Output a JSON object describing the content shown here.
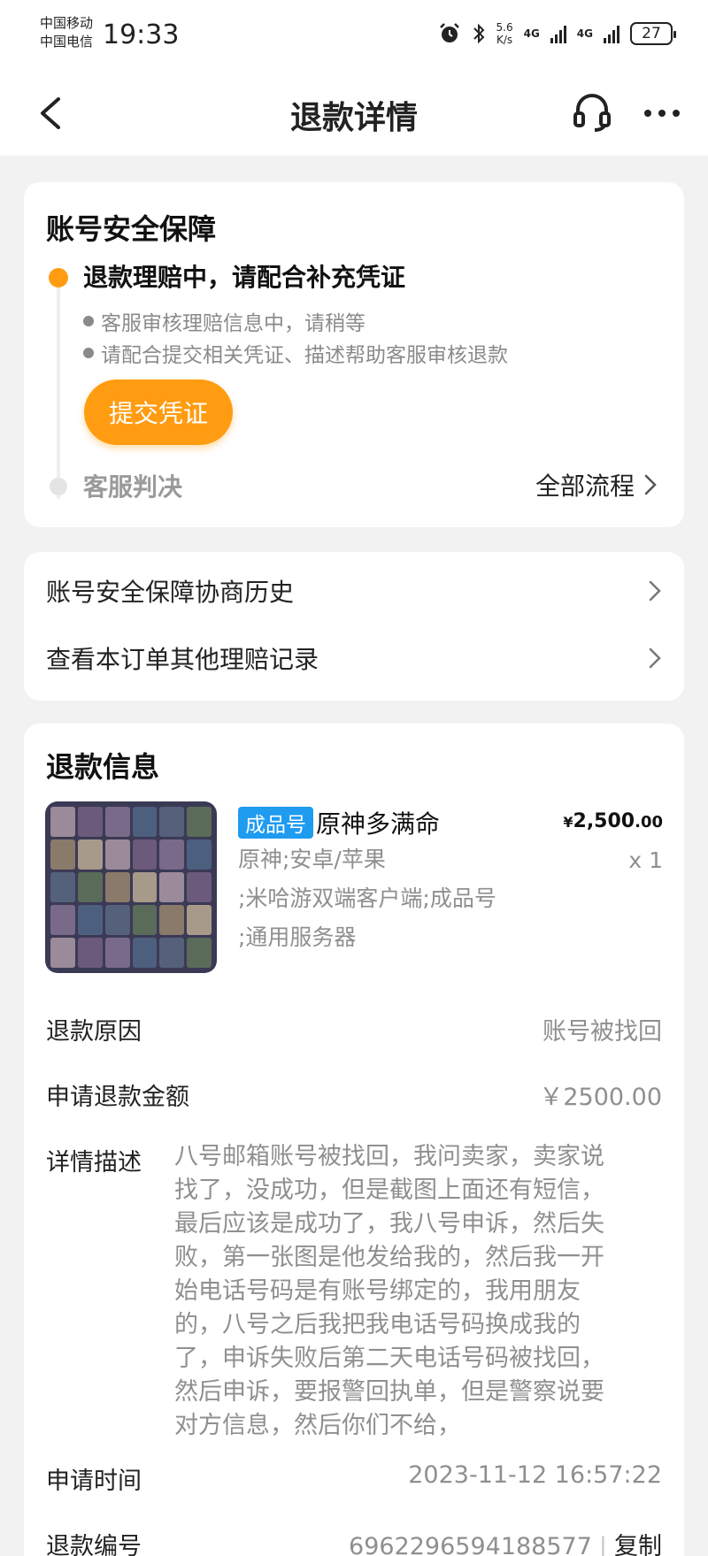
{
  "status_bar": {
    "carrier1": "中国移动",
    "carrier2": "中国电信",
    "time": "19:33",
    "speed_value": "5.6",
    "speed_unit": "K/s",
    "net1": "4G",
    "net2": "4G",
    "battery": "27"
  },
  "nav": {
    "title": "退款详情",
    "icons": [
      "back-icon",
      "headset-icon",
      "more-icon"
    ]
  },
  "security_card": {
    "title": "账号安全保障",
    "active_step": "退款理赔中，请配合补充凭证",
    "bullets": [
      "客服审核理赔信息中，请稍等",
      "请配合提交相关凭证、描述帮助客服审核退款"
    ],
    "submit_label": "提交凭证",
    "next_step": "客服判决",
    "all_flow_label": "全部流程"
  },
  "links": [
    {
      "label": "账号安全保障协商历史"
    },
    {
      "label": "查看本订单其他理赔记录"
    }
  ],
  "refund_info": {
    "title": "退款信息",
    "product": {
      "tag": "成品号",
      "name": "原神多满命",
      "attr_line1": "原神;安卓/苹果",
      "attr_line2": ";米哈游双端客户端;成品号",
      "attr_line3": ";通用服务器",
      "price_symbol": "¥",
      "price_int": "2,500",
      "price_dec": ".00",
      "qty": "x 1"
    },
    "reason_label": "退款原因",
    "reason_value": "账号被找回",
    "amount_label": "申请退款金额",
    "amount_value": "￥2500.00",
    "desc_label": "详情描述",
    "desc_lines": [
      "八号邮箱账号被找回，我问卖家，卖家说",
      "找了，没成功，但是截图上面还有短信，",
      "最后应该是成功了，我八号申诉，然后失",
      "败，第一张图是他发给我的，然后我一开",
      "始电话号码是有账号绑定的，我用朋友",
      "的，八号之后我把我电话号码换成我的",
      "了，申诉失败后第二天电话号码被找回，",
      "然后申诉，要报警回执单，但是警察说要",
      "对方信息，然后你们不给，"
    ],
    "time_label": "申请时间",
    "time_value": "2023-11-12 16:57:22",
    "refund_no_label": "退款编号",
    "refund_no_value": "6962296594188577",
    "copy_label": "复制"
  },
  "colors": {
    "accent": "#ff9c11",
    "tag_blue": "#1f9bf0",
    "background": "#f2f2f2"
  }
}
